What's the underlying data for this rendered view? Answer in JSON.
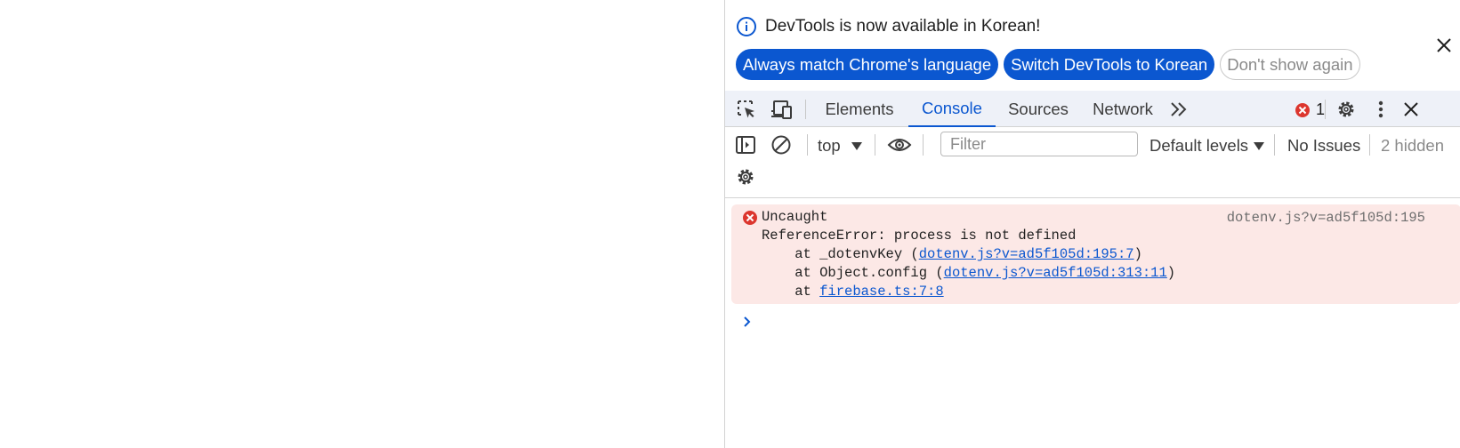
{
  "infobar": {
    "message": "DevTools is now available in Korean!",
    "buttons": {
      "always_match": "Always match Chrome's language",
      "switch": "Switch DevTools to Korean",
      "dont_show": "Don't show again"
    }
  },
  "tabs": [
    {
      "label": "Elements",
      "active": false
    },
    {
      "label": "Console",
      "active": true
    },
    {
      "label": "Sources",
      "active": false
    },
    {
      "label": "Network",
      "active": false
    }
  ],
  "error_count": "1",
  "console_toolbar": {
    "context": "top",
    "filter_placeholder": "Filter",
    "levels": "Default levels",
    "issues": "No Issues",
    "hidden": "2 hidden"
  },
  "error": {
    "title": "Uncaught",
    "message": "ReferenceError: process is not defined",
    "source": "dotenv.js?v=ad5f105d:195",
    "stack": [
      {
        "prefix": "    at _dotenvKey (",
        "link": "dotenv.js?v=ad5f105d:195:7",
        "suffix": ")"
      },
      {
        "prefix": "    at Object.config (",
        "link": "dotenv.js?v=ad5f105d:313:11",
        "suffix": ")"
      },
      {
        "prefix": "    at ",
        "link": "firebase.ts:7:8",
        "suffix": ""
      }
    ]
  },
  "colors": {
    "accent": "#0b57d0",
    "error_bg": "#fce8e6",
    "error_icon": "#dc362e",
    "toolbar_bg": "#eef1f8"
  },
  "icons": {
    "info": "info-icon",
    "close": "close-icon",
    "inspect": "inspect-element-icon",
    "device": "device-toolbar-icon",
    "more_tabs": "more-tabs-icon",
    "error": "error-icon",
    "settings": "gear-icon",
    "kebab": "more-vert-icon",
    "sidebar": "sidebar-toggle-icon",
    "clear": "clear-console-icon",
    "eye": "eye-icon",
    "prompt": "chevron-right-icon"
  }
}
